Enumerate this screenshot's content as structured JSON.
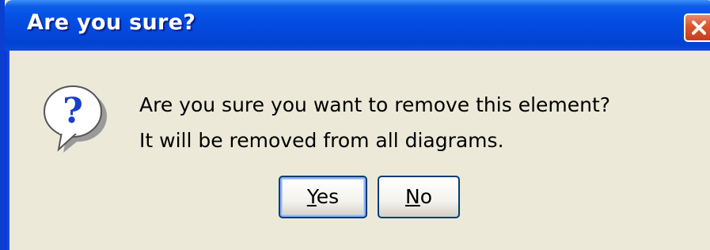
{
  "dialog": {
    "title": "Are you sure?",
    "message_line1": "Are you sure you want to remove this element?",
    "message_line2": "It will be removed from all diagrams.",
    "icon": "question-icon",
    "buttons": {
      "yes": {
        "mnemonic": "Y",
        "rest": "es"
      },
      "no": {
        "mnemonic": "N",
        "rest": "o"
      }
    },
    "colors": {
      "titlebar": "#0448dc",
      "body": "#ece9d8",
      "close": "#d9542e",
      "button_border": "#003c74"
    }
  }
}
